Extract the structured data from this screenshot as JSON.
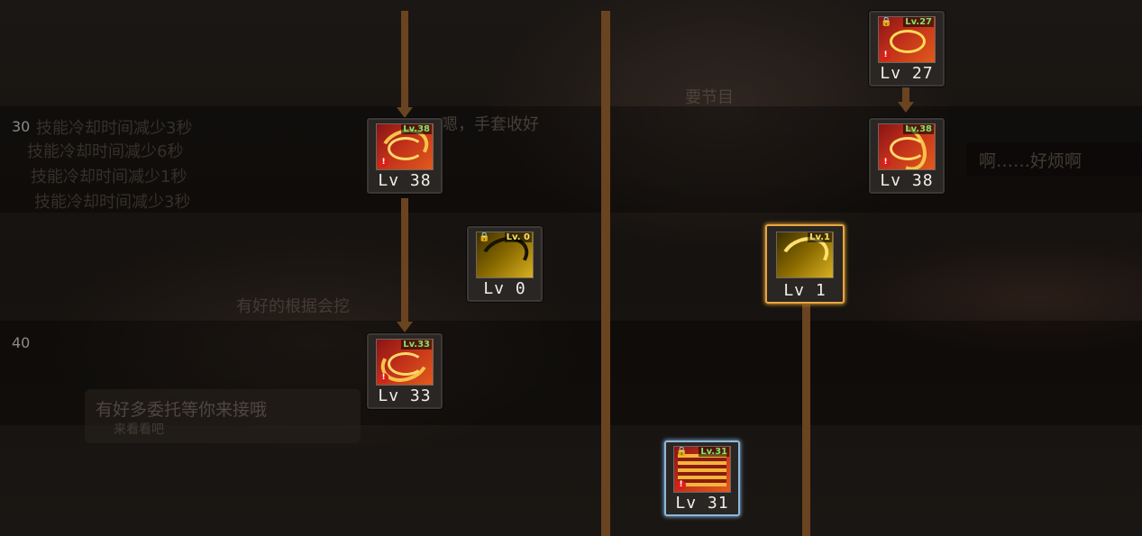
{
  "rows": {
    "level_30": "30",
    "level_40": "40"
  },
  "background_text": {
    "line_1": "技能冷却时间减少3秒",
    "line_2": "技能冷却时间减少6秒",
    "line_3": "技能冷却时间减少1秒",
    "line_4": "技能冷却时间减少3秒",
    "quest_hint": "有好多委托等你来接哦",
    "quest_sub": "来看看吧",
    "bubble_1": "啊……好烦啊",
    "bubble_1_sub": "……",
    "shout_1": "要节目",
    "shout_2": "有好的根据会挖",
    "shout_3": "嗯，手套收好"
  },
  "skills": [
    {
      "id": "skill-col2-top",
      "badge": "Lv.38",
      "level_label": "Lv 38",
      "locked": false,
      "warning": true,
      "style": "red"
    },
    {
      "id": "skill-col2-mid",
      "badge": "Lv.33",
      "level_label": "Lv 33",
      "locked": false,
      "warning": true,
      "style": "red"
    },
    {
      "id": "skill-col3",
      "badge": "Lv. 0",
      "level_label": "Lv 0",
      "locked": true,
      "warning": false,
      "style": "yellow"
    },
    {
      "id": "skill-col5",
      "badge": "Lv.31",
      "level_label": "Lv 31",
      "locked": true,
      "warning": true,
      "style": "red",
      "selected": "blue"
    },
    {
      "id": "skill-col6",
      "badge": "Lv.1",
      "level_label": "Lv 1",
      "locked": false,
      "warning": false,
      "style": "yellow",
      "selected": "gold"
    },
    {
      "id": "skill-col7-top",
      "badge": "Lv.27",
      "level_label": "Lv 27",
      "locked": true,
      "warning": true,
      "style": "red"
    },
    {
      "id": "skill-col7-mid",
      "badge": "Lv.38",
      "level_label": "Lv 38",
      "locked": false,
      "warning": true,
      "style": "red"
    }
  ],
  "colors": {
    "connector": "#6a4320",
    "level_text": "#f1eee9",
    "badge_green": "#7fe36a"
  }
}
